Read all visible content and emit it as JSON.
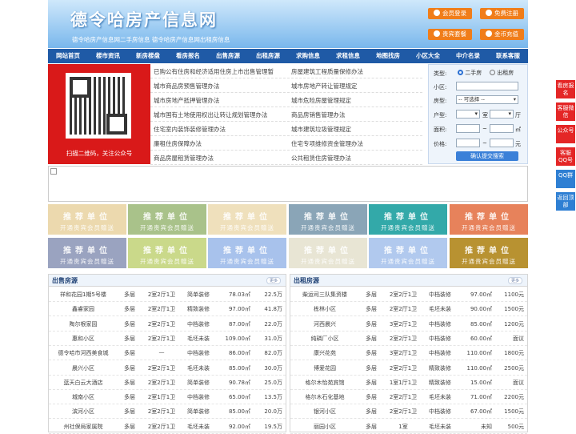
{
  "header": {
    "title": "德令哈房产信息网",
    "subtitle": "德令哈房产信息网二手房信息   德令哈房产信息网出租房信息",
    "buttons": [
      "会员登录",
      "免费注册",
      "贵宾套餐",
      "金币充值"
    ]
  },
  "nav": [
    "网站首页",
    "楼市资讯",
    "新房楼盘",
    "看房报名",
    "出售房源",
    "出租房源",
    "求购信息",
    "求租信息",
    "地图找房",
    "小区大全",
    "中介名录",
    "联系客服"
  ],
  "qr": {
    "caption": "扫描二维码，关注公众号"
  },
  "policy_links": [
    [
      "已购公有住房和经济适用住房上市出售管理暂",
      "房屋建筑工程质量保修办法"
    ],
    [
      "城市商品房预售管理办法",
      "城市房地产转让管理规定"
    ],
    [
      "城市房地产抵押管理办法",
      "城市危险房屋管理规定"
    ],
    [
      "城市国有土地使用权出让转让规划管理办法",
      "商品房销售管理办法"
    ],
    [
      "住宅室内装饰装修管理办法",
      "城市建筑垃圾管理规定"
    ],
    [
      "廉租住房保障办法",
      "住宅专项维修资金管理办法"
    ],
    [
      "商品房屋租赁管理办法",
      "公共租赁住房管理办法"
    ]
  ],
  "search": {
    "type_label": "类型:",
    "type_options": [
      "二手房",
      "出租房"
    ],
    "community_label": "小区:",
    "house_type_label": "房型:",
    "house_type_value": "-- 可选择 --",
    "layout_label": "户型:",
    "room_unit": "室",
    "hall_unit": "厅",
    "area_label": "面积:",
    "area_sep": "~",
    "area_unit": "㎡",
    "price_label": "价格:",
    "price_sep": "~",
    "price_unit": "元",
    "submit": "确认提交搜索"
  },
  "recommend": {
    "title": "推荐单位",
    "subtitle": "开通贵宾会员赠送",
    "colors": [
      "#ecd9ae",
      "#a9c28a",
      "#efe0bc",
      "#8aa5b7",
      "#33a9a9",
      "#e7825b",
      "#9aa3c0",
      "#cad98a",
      "#a8c2ec",
      "#e8e5d4",
      "#b1c9ee",
      "#b89231"
    ]
  },
  "sidebar": [
    "看房报名",
    "客服微信",
    "公众号",
    "客服QQ号",
    "QQ群",
    "返回顶部"
  ],
  "sale_panel": {
    "title": "出售房源",
    "more": "更多",
    "rows": [
      [
        "祥和花园1期5号楼",
        "多层",
        "2室2厅1卫",
        "简单装修",
        "78.03㎡",
        "22.5万"
      ],
      [
        "鑫睿家园",
        "多层",
        "2室2厅1卫",
        "精致装修",
        "97.00㎡",
        "41.8万"
      ],
      [
        "陶尔根家园",
        "多层",
        "2室2厅1卫",
        "中档装修",
        "87.00㎡",
        "22.0万"
      ],
      [
        "惠和小区",
        "多层",
        "2室2厅1卫",
        "毛坯未装",
        "109.00㎡",
        "31.0万"
      ],
      [
        "德令哈市河西美食城",
        "多层",
        "—",
        "中档装修",
        "86.00㎡",
        "82.0万"
      ],
      [
        "晨兴小区",
        "多层",
        "2室2厅1卫",
        "毛坯未装",
        "85.00㎡",
        "30.0万"
      ],
      [
        "蓝天白云大酒店",
        "多层",
        "2室2厅1卫",
        "简单装修",
        "90.78㎡",
        "25.0万"
      ],
      [
        "城南小区",
        "多层",
        "2室1厅1卫",
        "中档装修",
        "65.00㎡",
        "13.5万"
      ],
      [
        "滨河小区",
        "多层",
        "2室2厅1卫",
        "简单装修",
        "85.00㎡",
        "20.0万"
      ],
      [
        "州社保局家属院",
        "多层",
        "2室2厅1卫",
        "毛坯未装",
        "92.00㎡",
        "19.5万"
      ]
    ]
  },
  "rent_panel": {
    "title": "出租房源",
    "more": "更多",
    "rows": [
      [
        "柴运司三队集资楼",
        "多层",
        "2室2厅1卫",
        "中档装修",
        "97.00㎡",
        "1100元"
      ],
      [
        "栋林小区",
        "多层",
        "2室2厅1卫",
        "毛坯未装",
        "90.00㎡",
        "1500元"
      ],
      [
        "河西晨兴",
        "多层",
        "3室2厅1卫",
        "中档装修",
        "85.00㎡",
        "1200元"
      ],
      [
        "纯磷厂小区",
        "多层",
        "2室2厅1卫",
        "中档装修",
        "60.00㎡",
        "面议"
      ],
      [
        "康兴花苑",
        "多层",
        "3室2厅1卫",
        "中档装修",
        "110.00㎡",
        "1800元"
      ],
      [
        "博爱花园",
        "多层",
        "2室2厅1卫",
        "精致装修",
        "110.00㎡",
        "2500元"
      ],
      [
        "格尔木怡苑宾馆",
        "多层",
        "1室1厅1卫",
        "精致装修",
        "15.00㎡",
        "面议"
      ],
      [
        "格尔木石化基地",
        "多层",
        "2室2厅1卫",
        "毛坯未装",
        "71.00㎡",
        "2200元"
      ],
      [
        "银河小区",
        "多层",
        "2室2厅1卫",
        "中档装修",
        "67.00㎡",
        "1500元"
      ],
      [
        "丽园小区",
        "多层",
        "1室",
        "毛坯未装",
        "未知",
        "500元"
      ]
    ]
  }
}
